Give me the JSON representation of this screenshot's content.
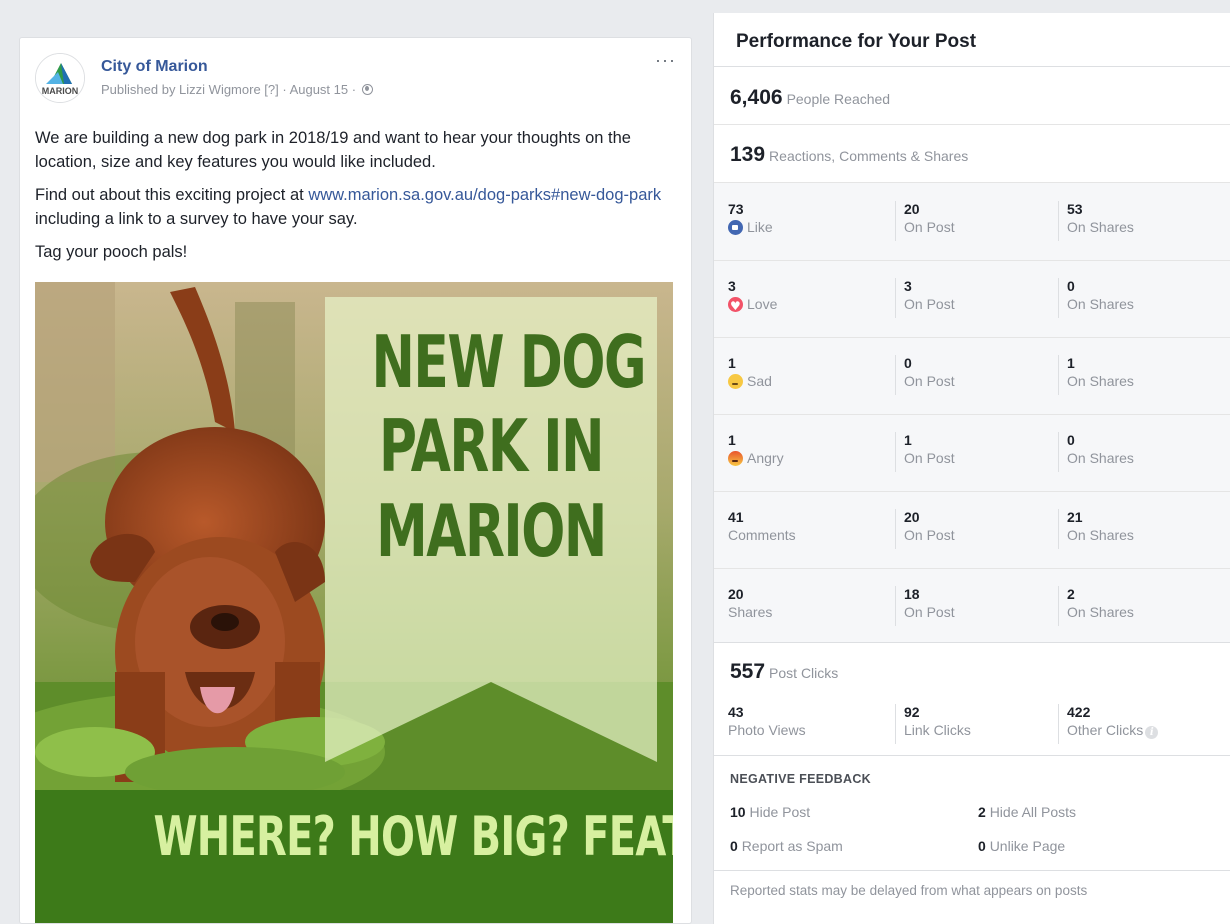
{
  "post": {
    "page_name": "City of Marion",
    "byline": "Published by Lizzi Wigmore [?] · August 15 · ",
    "more": "···",
    "paragraph1": "We are building a new dog park in 2018/19 and want to hear your thoughts on the location, size and key features you would like included.",
    "paragraph2_prefix": "Find out about this exciting project at ",
    "paragraph2_link": "www.marion.sa.gov.au/dog-parks#new-dog-park",
    "paragraph2_suffix": " including a link to a survey to have your say.",
    "paragraph3": "Tag your pooch pals!",
    "logo_text": "MARION",
    "image": {
      "banner_line1": "NEW DOG",
      "banner_line2": "PARK IN",
      "banner_line3": "MARION",
      "bottom_text": "WHERE? HOW BIG? FEATURES?"
    }
  },
  "panel": {
    "title": "Performance for Your Post",
    "reach": {
      "value": "6,406",
      "label": "People Reached"
    },
    "engagement": {
      "value": "139",
      "label": "Reactions, Comments & Shares"
    },
    "rows": [
      {
        "total": "73",
        "label": "Like",
        "icon": "like-icon",
        "on_post": "20",
        "on_post_label": "On Post",
        "on_shares": "53",
        "on_shares_label": "On Shares"
      },
      {
        "total": "3",
        "label": "Love",
        "icon": "love-icon",
        "on_post": "3",
        "on_post_label": "On Post",
        "on_shares": "0",
        "on_shares_label": "On Shares"
      },
      {
        "total": "1",
        "label": "Sad",
        "icon": "sad-icon",
        "on_post": "0",
        "on_post_label": "On Post",
        "on_shares": "1",
        "on_shares_label": "On Shares"
      },
      {
        "total": "1",
        "label": "Angry",
        "icon": "angry-icon",
        "on_post": "1",
        "on_post_label": "On Post",
        "on_shares": "0",
        "on_shares_label": "On Shares"
      },
      {
        "total": "41",
        "label": "Comments",
        "icon": "",
        "on_post": "20",
        "on_post_label": "On Post",
        "on_shares": "21",
        "on_shares_label": "On Shares"
      },
      {
        "total": "20",
        "label": "Shares",
        "icon": "",
        "on_post": "18",
        "on_post_label": "On Post",
        "on_shares": "2",
        "on_shares_label": "On Shares"
      }
    ],
    "clicks": {
      "value": "557",
      "label": "Post Clicks",
      "photo_views": "43",
      "photo_views_label": "Photo Views",
      "link_clicks": "92",
      "link_clicks_label": "Link Clicks",
      "other_clicks": "422",
      "other_clicks_label": "Other Clicks"
    },
    "negative": {
      "title": "NEGATIVE FEEDBACK",
      "hide_post": "10",
      "hide_post_label": "Hide Post",
      "hide_all": "2",
      "hide_all_label": "Hide All Posts",
      "spam": "0",
      "spam_label": "Report as Spam",
      "unlike": "0",
      "unlike_label": "Unlike Page"
    },
    "footer": "Reported stats may be delayed from what appears on posts"
  }
}
